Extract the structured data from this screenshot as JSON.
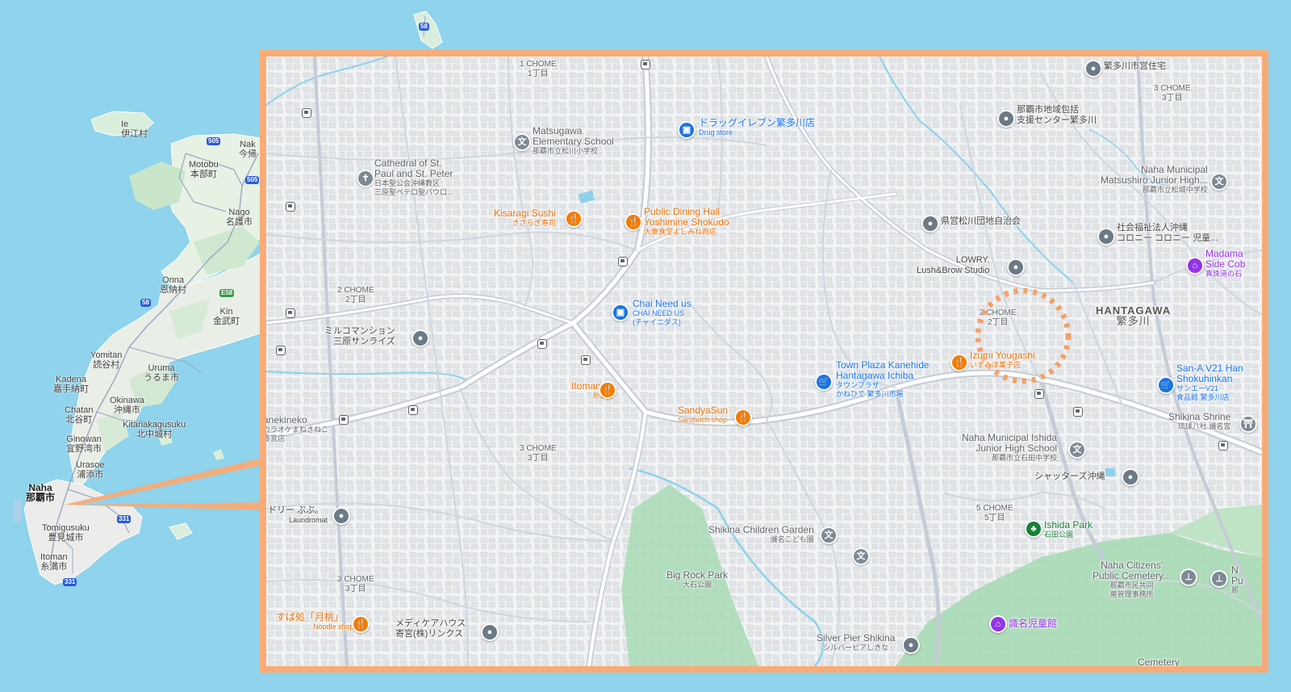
{
  "overview": {
    "places": [
      {
        "id": "ie",
        "name": "Ie",
        "jp": "伊江村"
      },
      {
        "id": "motobu",
        "name": "Motobu",
        "jp": "本部町"
      },
      {
        "id": "nago",
        "name": "Nago",
        "jp": "名護市"
      },
      {
        "id": "nakijin",
        "name": "Nak",
        "jp": "今帰"
      },
      {
        "id": "onna",
        "name": "Onna",
        "jp": "恩納村"
      },
      {
        "id": "kin",
        "name": "Kin",
        "jp": "金武町"
      },
      {
        "id": "yomitan",
        "name": "Yomitan",
        "jp": "読谷村"
      },
      {
        "id": "uruma",
        "name": "Uruma",
        "jp": "うるま市"
      },
      {
        "id": "kadena",
        "name": "Kadena",
        "jp": "嘉手納町"
      },
      {
        "id": "okinawa",
        "name": "Okinawa",
        "jp": "沖縄市"
      },
      {
        "id": "chatan",
        "name": "Chatan",
        "jp": "北谷町"
      },
      {
        "id": "kitanakagusuku",
        "name": "Kitanakagusuku",
        "jp": "北中城村"
      },
      {
        "id": "ginowan",
        "name": "Ginowan",
        "jp": "宜野湾市"
      },
      {
        "id": "urasoe",
        "name": "Urasoe",
        "jp": "浦添市"
      },
      {
        "id": "naha",
        "name": "Naha",
        "jp": "那覇市"
      },
      {
        "id": "tomigusuku",
        "name": "Tomigusuku",
        "jp": "豊見城市"
      },
      {
        "id": "itoman",
        "name": "Itoman",
        "jp": "糸満市"
      }
    ],
    "shields": [
      "58",
      "505",
      "505",
      "58",
      "E58",
      "331",
      "331"
    ]
  },
  "inset": {
    "neighborhoods": [
      {
        "id": "chome1-top",
        "en": "1 CHOME",
        "jp": "1丁目"
      },
      {
        "id": "chome2-left",
        "en": "2 CHOME",
        "jp": "2丁目"
      },
      {
        "id": "chome3-mid",
        "en": "3 CHOME",
        "jp": "3丁目"
      },
      {
        "id": "chome3-bl",
        "en": "3 CHOME",
        "jp": "3丁目"
      },
      {
        "id": "chome3-tr",
        "en": "3 CHOME",
        "jp": "3丁目"
      },
      {
        "id": "chome2-right",
        "en": "2 CHOME",
        "jp": "2丁目"
      },
      {
        "id": "chome5",
        "en": "5 CHOME",
        "jp": "5丁目"
      }
    ],
    "area": {
      "en": "HANTAGAWA",
      "jp": "繁多川"
    },
    "pois": [
      {
        "id": "matsugawa-school",
        "name": "Matsugawa\nElementary School",
        "sub": "那覇市立松川小学校",
        "kind": "gray",
        "icon": "school"
      },
      {
        "id": "cathedral",
        "name": "Cathedral of St.\nPaul and St. Peter",
        "sub": "日本聖公会沖縄教区\n三原聖ペテロ聖パウロ...",
        "kind": "gray",
        "icon": "church"
      },
      {
        "id": "drugstore",
        "name": "ドラッグイレブン繁多川店",
        "sub": "Drug store",
        "kind": "blue",
        "icon": "shop"
      },
      {
        "id": "kisaragi",
        "name": "Kisaragi Sushi",
        "sub": "きさらぎ寿司",
        "kind": "orange",
        "icon": "food"
      },
      {
        "id": "yoshimine",
        "name": "Public Dining Hall\nYoshimine Shokudo",
        "sub": "大衆食堂よしみね商店",
        "kind": "orange",
        "icon": "food"
      },
      {
        "id": "chai",
        "name": "Chai Need us",
        "sub": "CHAI NEED US\n(チャイニダス)",
        "kind": "blue",
        "icon": "shop"
      },
      {
        "id": "milcomansion",
        "name": "ミルコマンション\n三原サンライズ",
        "sub": "",
        "kind": "dark",
        "icon": "place"
      },
      {
        "id": "itomanya",
        "name": "Itoman-ya",
        "sub": "糸満屋",
        "kind": "orange",
        "icon": "food"
      },
      {
        "id": "sandyasun",
        "name": "SandyaSun",
        "sub": "Sandwich shop",
        "kind": "orange",
        "icon": "food"
      },
      {
        "id": "townplaza",
        "name": "Town Plaza Kanehide\nHantagawa Ichiba",
        "sub": "タウンプラザ\nかねひで 繁多川市場",
        "kind": "blue",
        "icon": "cart"
      },
      {
        "id": "hantagawa-housing",
        "name": "繁多川市営住宅",
        "sub": "",
        "kind": "dark",
        "icon": "place"
      },
      {
        "id": "support-center",
        "name": "那覇市地域包括\n支援センター繁多川",
        "sub": "",
        "kind": "dark",
        "icon": "place"
      },
      {
        "id": "matsushiro-jhs",
        "name": "Naha Municipal\nMatsushiro Junior High...",
        "sub": "那覇市立松城中学校",
        "kind": "gray",
        "icon": "school"
      },
      {
        "id": "kenei",
        "name": "県営松川団地自治会",
        "sub": "",
        "kind": "dark",
        "icon": "place"
      },
      {
        "id": "colony",
        "name": "社会福祉法人沖縄\nコロニー コロニー 児童...",
        "sub": "",
        "kind": "dark",
        "icon": "place"
      },
      {
        "id": "lowry",
        "name": "LOWRY.\nLush&Brow Studio",
        "sub": "",
        "kind": "dark",
        "icon": "place"
      },
      {
        "id": "madama",
        "name": "Madama\nSide Cob",
        "sub": "真珠道の石",
        "kind": "purple",
        "icon": "landmark"
      },
      {
        "id": "izumi",
        "name": "Izumi Yougashi",
        "sub": "いずみ洋菓子店",
        "kind": "orange",
        "icon": "food"
      },
      {
        "id": "san-a",
        "name": "San-A V21 Han\nShokuhinkan",
        "sub": "サンエーV21\n食品館 繁多川店",
        "kind": "blue",
        "icon": "cart"
      },
      {
        "id": "shikina-shrine",
        "name": "Shikina Shrine",
        "sub": "琉球八社 識名宮",
        "kind": "gray",
        "icon": "shrine"
      },
      {
        "id": "ishida-jhs",
        "name": "Naha Municipal Ishida\nJunior High School",
        "sub": "那覇市立石田中学校",
        "kind": "gray",
        "icon": "school"
      },
      {
        "id": "shutters",
        "name": "シャッターズ沖縄",
        "sub": "",
        "kind": "dark",
        "icon": "place"
      },
      {
        "id": "ishida-park",
        "name": "Ishida Park",
        "sub": "石田公園",
        "kind": "green",
        "icon": "tree"
      },
      {
        "id": "laundromat",
        "name": "ドリー ぷぷ。",
        "sub": "Laundromat",
        "kind": "dark",
        "icon": "place"
      },
      {
        "id": "sekineko",
        "name": "anekineko",
        "sub": "カラオケまねきねこ\n寄宮店",
        "kind": "gray",
        "icon": "none"
      },
      {
        "id": "shikina-garden",
        "name": "Shikina Children Garden",
        "sub": "識名こども園",
        "kind": "gray",
        "icon": "school"
      },
      {
        "id": "big-rock",
        "name": "Big Rock Park",
        "sub": "大石公園",
        "kind": "gray",
        "icon": "none"
      },
      {
        "id": "citizens-cemetery",
        "name": "Naha Citizens'\nPublic Cemetery...",
        "sub": "那覇市民共同\n墓管理事務所",
        "kind": "gray",
        "icon": "none"
      },
      {
        "id": "nu-pu",
        "name": "N\nPu",
        "sub": "那",
        "kind": "gray",
        "icon": "none"
      },
      {
        "id": "tsukimomo",
        "name": "すば処「月桃」",
        "sub": "Noodle shop",
        "kind": "orange",
        "icon": "food"
      },
      {
        "id": "mediacare",
        "name": "メディケアハウス\n寄宮(株)リンクス",
        "sub": "",
        "kind": "dark",
        "icon": "place"
      },
      {
        "id": "silver-pier",
        "name": "Silver Pier Shikina",
        "sub": "シルバーピアしきな",
        "kind": "gray",
        "icon": "place"
      },
      {
        "id": "shikina-jidokan",
        "name": "識名児童館",
        "sub": "",
        "kind": "purple",
        "icon": "landmark"
      },
      {
        "id": "cemetery-cut",
        "name": "Cemetery",
        "sub": "",
        "kind": "gray",
        "icon": "none"
      }
    ]
  },
  "colors": {
    "water": "#8fd3ec",
    "land": "#eef0ee",
    "frame": "#f8ab76",
    "highlight": "#f5a06a",
    "food": "#f57c00",
    "shop": "#1a73e8",
    "park": "#a8dab5"
  }
}
